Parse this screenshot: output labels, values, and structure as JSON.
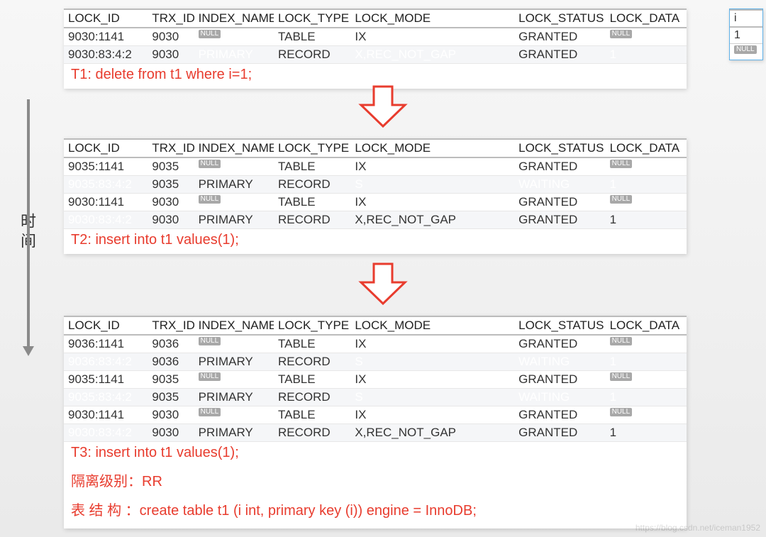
{
  "timeline_label": "时间",
  "headers": [
    "LOCK_ID",
    "TRX_ID",
    "INDEX_NAME",
    "LOCK_TYPE",
    "LOCK_MODE",
    "LOCK_STATUS",
    "LOCK_DATA"
  ],
  "null_label": "NULL",
  "panels": [
    {
      "note": "T1: delete from t1 where i=1;",
      "rows": [
        {
          "lock_id": "9030:1141",
          "trx_id": "9030",
          "index": null,
          "type": "TABLE",
          "mode": "IX",
          "status": "GRANTED",
          "data": null,
          "hl": []
        },
        {
          "lock_id": "9030:83:4:2",
          "trx_id": "9030",
          "index": "PRIMARY",
          "type": "RECORD",
          "mode": "X,REC_NOT_GAP",
          "status": "GRANTED",
          "data": "1",
          "hl": [
            "index",
            "mode",
            "data"
          ]
        }
      ]
    },
    {
      "note": "T2: insert into t1 values(1);",
      "rows": [
        {
          "lock_id": "9035:1141",
          "trx_id": "9035",
          "index": null,
          "type": "TABLE",
          "mode": "IX",
          "status": "GRANTED",
          "data": null,
          "hl": []
        },
        {
          "lock_id": "9035:83:4:2",
          "trx_id": "9035",
          "index": "PRIMARY",
          "type": "RECORD",
          "mode": "S",
          "status": "WAITING",
          "data": "1",
          "hl": [
            "lockid",
            "mode",
            "status",
            "data"
          ]
        },
        {
          "lock_id": "9030:1141",
          "trx_id": "9030",
          "index": null,
          "type": "TABLE",
          "mode": "IX",
          "status": "GRANTED",
          "data": null,
          "hl": []
        },
        {
          "lock_id": "9030:83:4:2",
          "trx_id": "9030",
          "index": "PRIMARY",
          "type": "RECORD",
          "mode": "X,REC_NOT_GAP",
          "status": "GRANTED",
          "data": "1",
          "hl": [
            "lockid"
          ]
        }
      ]
    },
    {
      "note": "T3: insert into t1 values(1);",
      "rows": [
        {
          "lock_id": "9036:1141",
          "trx_id": "9036",
          "index": null,
          "type": "TABLE",
          "mode": "IX",
          "status": "GRANTED",
          "data": null,
          "hl": []
        },
        {
          "lock_id": "9036:83:4:2",
          "trx_id": "9036",
          "index": "PRIMARY",
          "type": "RECORD",
          "mode": "S",
          "status": "WAITING",
          "data": "1",
          "hl": [
            "lockid",
            "mode",
            "status",
            "data"
          ]
        },
        {
          "lock_id": "9035:1141",
          "trx_id": "9035",
          "index": null,
          "type": "TABLE",
          "mode": "IX",
          "status": "GRANTED",
          "data": null,
          "hl": []
        },
        {
          "lock_id": "9035:83:4:2",
          "trx_id": "9035",
          "index": "PRIMARY",
          "type": "RECORD",
          "mode": "S",
          "status": "WAITING",
          "data": "1",
          "hl": [
            "lockid",
            "mode",
            "status",
            "data"
          ]
        },
        {
          "lock_id": "9030:1141",
          "trx_id": "9030",
          "index": null,
          "type": "TABLE",
          "mode": "IX",
          "status": "GRANTED",
          "data": null,
          "hl": []
        },
        {
          "lock_id": "9030:83:4:2",
          "trx_id": "9030",
          "index": "PRIMARY",
          "type": "RECORD",
          "mode": "X,REC_NOT_GAP",
          "status": "GRANTED",
          "data": "1",
          "hl": [
            "lockid"
          ]
        }
      ],
      "extra_notes": [
        "隔离级别：RR",
        "表 结 构 ：create table t1 (i int, primary key (i)) engine = InnoDB;"
      ]
    }
  ],
  "mini_table": {
    "header": "i",
    "rows": [
      "1",
      null
    ]
  },
  "watermark": "https://blog.csdn.net/iceman1952"
}
